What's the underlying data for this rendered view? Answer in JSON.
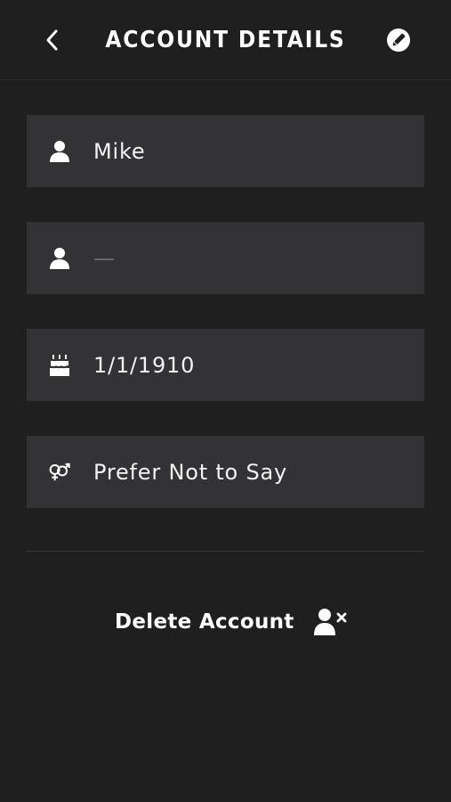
{
  "header": {
    "title": "ACCOUNT DETAILS",
    "back_icon": "chevron-left-icon",
    "edit_icon": "pencil-circle-icon"
  },
  "fields": [
    {
      "icon": "person-icon",
      "value": "Mike"
    },
    {
      "icon": "person-icon",
      "value": "—"
    },
    {
      "icon": "birthday-cake-icon",
      "value": "1/1/1910"
    },
    {
      "icon": "gender-icon",
      "value": "Prefer Not to Say"
    }
  ],
  "delete_account": {
    "label": "Delete Account",
    "icon": "remove-user-icon"
  },
  "colors": {
    "background": "#1f1f20",
    "field_background": "#333335",
    "text": "#ffffff",
    "placeholder": "#6f6f72"
  }
}
